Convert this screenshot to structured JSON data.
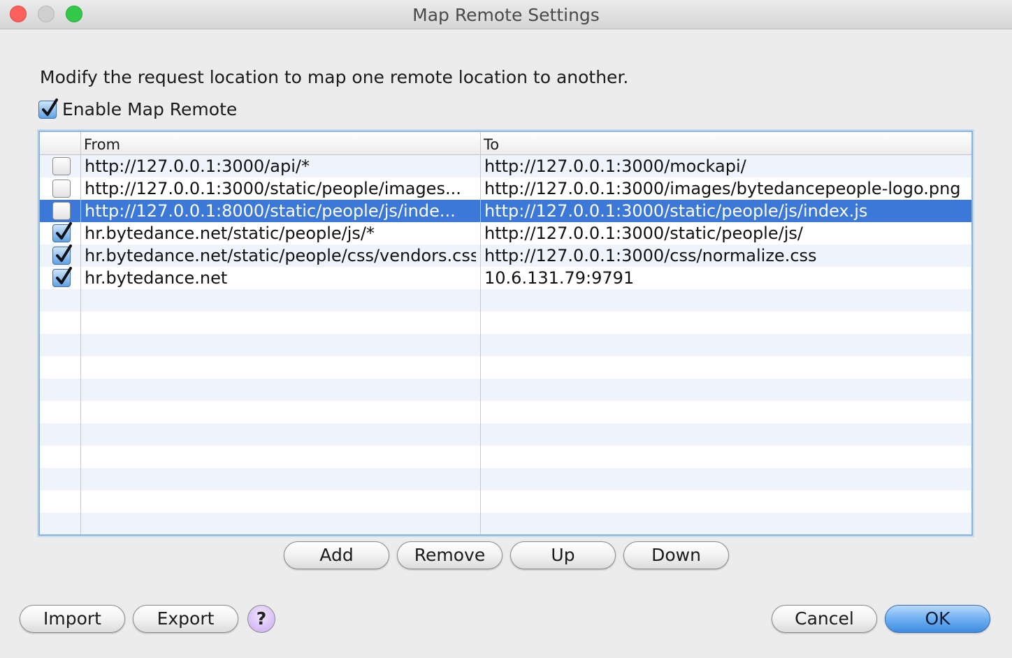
{
  "window": {
    "title": "Map Remote Settings"
  },
  "description": "Modify the request location to map one remote location to another.",
  "enable": {
    "label": "Enable Map Remote",
    "checked": true
  },
  "table": {
    "columns": {
      "from": "From",
      "to": "To"
    },
    "rows": [
      {
        "enabled": false,
        "from": "http://127.0.0.1:3000/api/*",
        "to": "http://127.0.0.1:3000/mockapi/",
        "selected": false
      },
      {
        "enabled": false,
        "from": "http://127.0.0.1:3000/static/people/images...",
        "to": "http://127.0.0.1:3000/images/bytedancepeople-logo.png",
        "selected": false
      },
      {
        "enabled": false,
        "from": "http://127.0.0.1:8000/static/people/js/inde...",
        "to": "http://127.0.0.1:3000/static/people/js/index.js",
        "selected": true
      },
      {
        "enabled": true,
        "from": "hr.bytedance.net/static/people/js/*",
        "to": "http://127.0.0.1:3000/static/people/js/",
        "selected": false
      },
      {
        "enabled": true,
        "from": "hr.bytedance.net/static/people/css/vendors.css",
        "to": "http://127.0.0.1:3000/css/normalize.css",
        "selected": false
      },
      {
        "enabled": true,
        "from": "hr.bytedance.net",
        "to": "10.6.131.79:9791",
        "selected": false
      }
    ]
  },
  "buttons": {
    "add": "Add",
    "remove": "Remove",
    "up": "Up",
    "down": "Down",
    "import": "Import",
    "export": "Export",
    "help": "?",
    "cancel": "Cancel",
    "ok": "OK"
  },
  "colors": {
    "selection": "#3c78d8",
    "stripe": "#eef3fc",
    "accent": "#3f8be0"
  }
}
